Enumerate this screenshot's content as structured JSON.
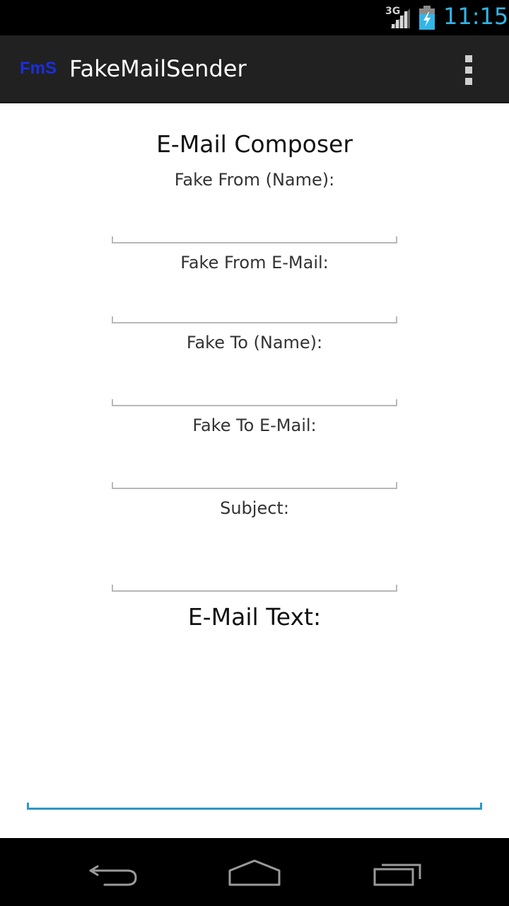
{
  "status_bar": {
    "network_type": "3G",
    "time": "11:15",
    "accent_color": "#33b5e5"
  },
  "action_bar": {
    "logo_text": "FmS",
    "title": "FakeMailSender",
    "overflow_icon": "overflow-menu-icon"
  },
  "composer": {
    "title": "E-Mail Composer",
    "fields": [
      {
        "label": "Fake From (Name):",
        "value": ""
      },
      {
        "label": "Fake From E-Mail:",
        "value": ""
      },
      {
        "label": "Fake To (Name):",
        "value": ""
      },
      {
        "label": "Fake To E-Mail:",
        "value": ""
      },
      {
        "label": "Subject:",
        "value": ""
      }
    ],
    "body_label": "E-Mail Text:",
    "body_value": "",
    "focus_color": "#2e96c8"
  },
  "nav_bar": {
    "back_icon": "back-icon",
    "home_icon": "home-icon",
    "recents_icon": "recent-apps-icon"
  }
}
